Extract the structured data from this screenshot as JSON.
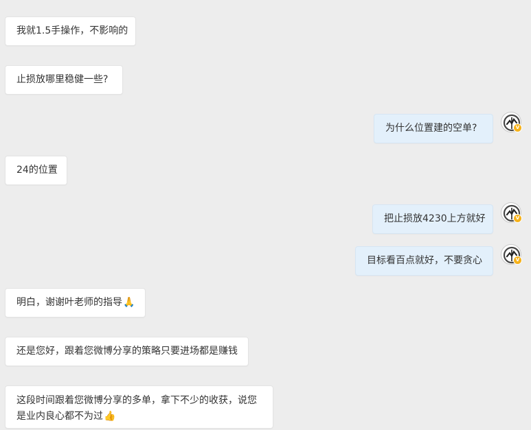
{
  "messages": [
    {
      "side": "left",
      "text": "我就1.5手操作，不影响的"
    },
    {
      "side": "left",
      "text": "止损放哪里稳健一些?"
    },
    {
      "side": "right",
      "text": "为什么位置建的空单?"
    },
    {
      "side": "left",
      "text": "24的位置"
    },
    {
      "side": "right",
      "text": "把止损放4230上方就好"
    },
    {
      "side": "right",
      "text": "目标看百点就好，不要贪心"
    },
    {
      "side": "left",
      "text": "明白，谢谢叶老师的指导",
      "emoji": "🙏"
    },
    {
      "side": "left",
      "text": "还是您好，跟着您微博分享的策略只要进场都是赚钱"
    },
    {
      "side": "left",
      "text_line1": "这段时间跟着您微博分享的多单，拿下不少的收获，说您",
      "text_line2": "是业内良心都不为过",
      "emoji": "👍"
    }
  ],
  "avatar": {
    "icon": "teacher-avatar-icon",
    "badge_label": "V",
    "badge_color": "#f6b21b"
  },
  "colors": {
    "background": "#ededed",
    "left_bubble": "#ffffff",
    "right_bubble": "#e3f0fb",
    "text": "#333333"
  }
}
